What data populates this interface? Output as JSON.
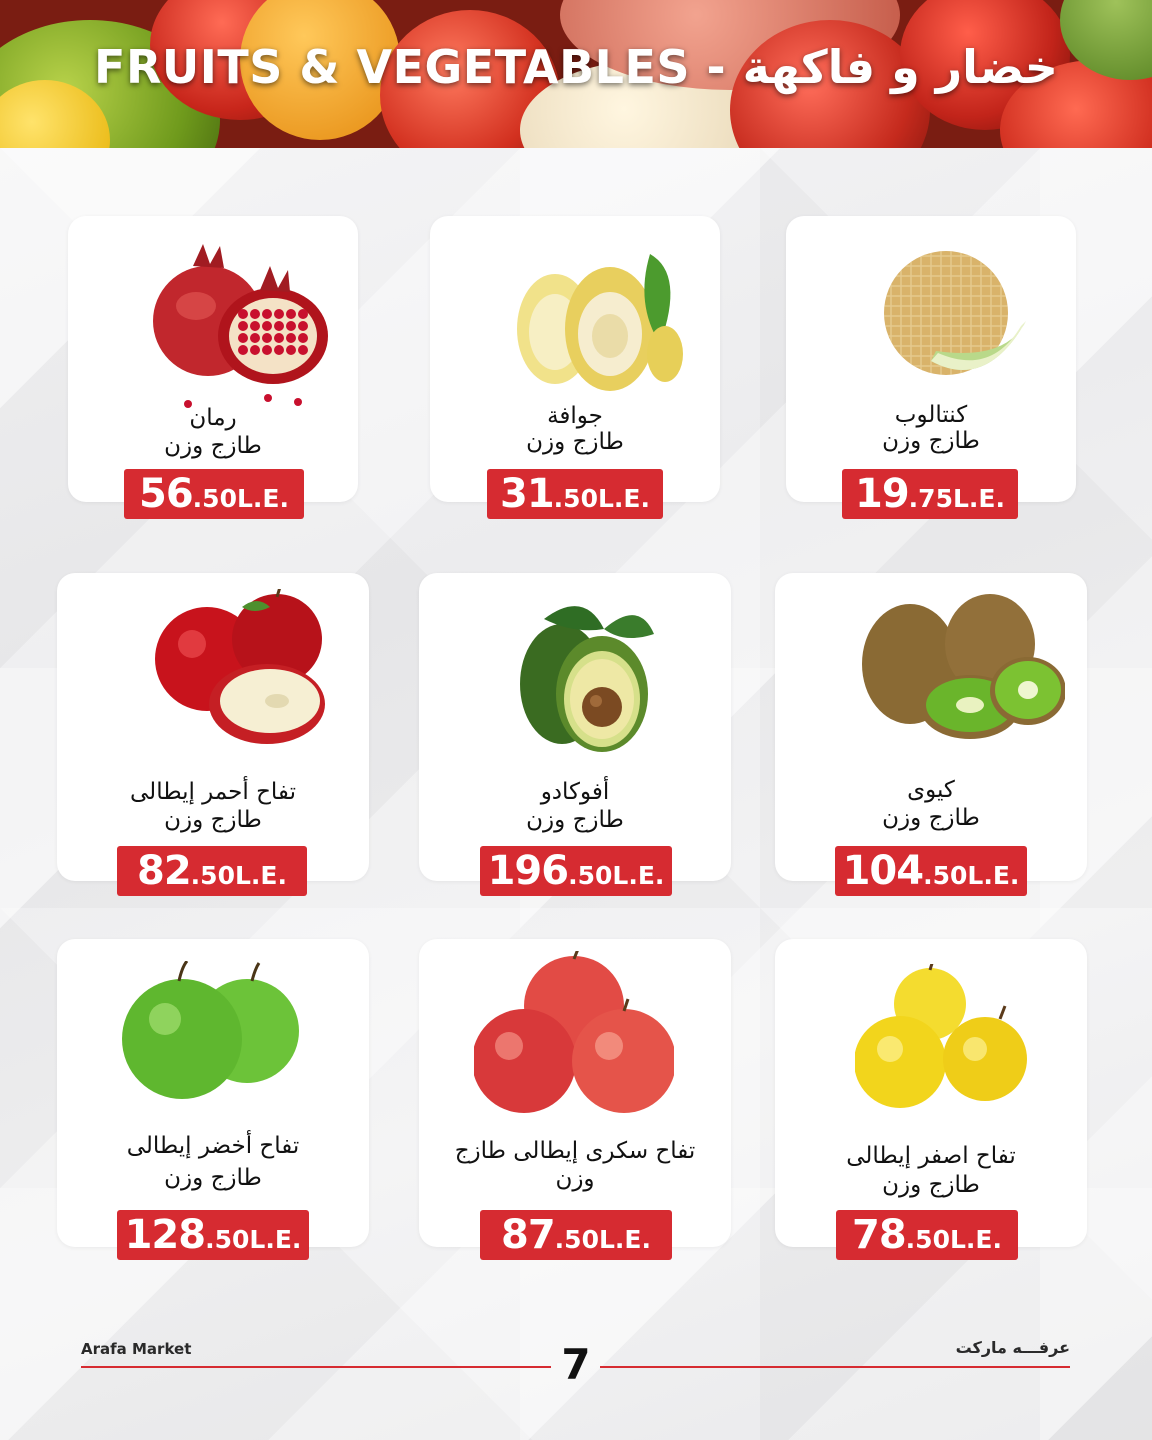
{
  "header": {
    "title": "FRUITS & VEGETABLES - خضار و فاكهة"
  },
  "products": [
    {
      "name_line1": "رمان",
      "name_line2": "طازج وزن",
      "price_int": "56",
      "price_frac": ".50",
      "currency": "L.E.",
      "icon": "pomegranate-image"
    },
    {
      "name_line1": "جوافة",
      "name_line2": "طازج وزن",
      "price_int": "31",
      "price_frac": ".50",
      "currency": "L.E.",
      "icon": "guava-image"
    },
    {
      "name_line1": "كنتالوب",
      "name_line2": "طازج وزن",
      "price_int": "19",
      "price_frac": ".75",
      "currency": "L.E.",
      "icon": "cantaloupe-image"
    },
    {
      "name_line1": "تفاح أحمر إيطالى",
      "name_line2": "طازج وزن",
      "price_int": "82",
      "price_frac": ".50",
      "currency": "L.E.",
      "icon": "red-apple-image"
    },
    {
      "name_line1": "أفوكادو",
      "name_line2": "طازج وزن",
      "price_int": "196",
      "price_frac": ".50",
      "currency": "L.E.",
      "icon": "avocado-image"
    },
    {
      "name_line1": "كيوى",
      "name_line2": "طازج وزن",
      "price_int": "104",
      "price_frac": ".50",
      "currency": "L.E.",
      "icon": "kiwi-image"
    },
    {
      "name_line1": "تفاح أخضر إيطالى",
      "name_line2": "طازج وزن",
      "price_int": "128",
      "price_frac": ".50",
      "currency": "L.E.",
      "icon": "green-apple-image"
    },
    {
      "name_line1": "تفاح سكرى إيطالى طازج",
      "name_line2": "وزن",
      "price_int": "87",
      "price_frac": ".50",
      "currency": "L.E.",
      "icon": "sugar-apple-image"
    },
    {
      "name_line1": "تفاح اصفر إيطالى",
      "name_line2": "طازج وزن",
      "price_int": "78",
      "price_frac": ".50",
      "currency": "L.E.",
      "icon": "yellow-apple-image"
    }
  ],
  "footer": {
    "brand_en": "Arafa Market",
    "brand_ar": "عرفـــه ماركت",
    "page_number": "7"
  },
  "colors": {
    "price_badge": "#d62b31",
    "footer_line": "#d62b31"
  }
}
